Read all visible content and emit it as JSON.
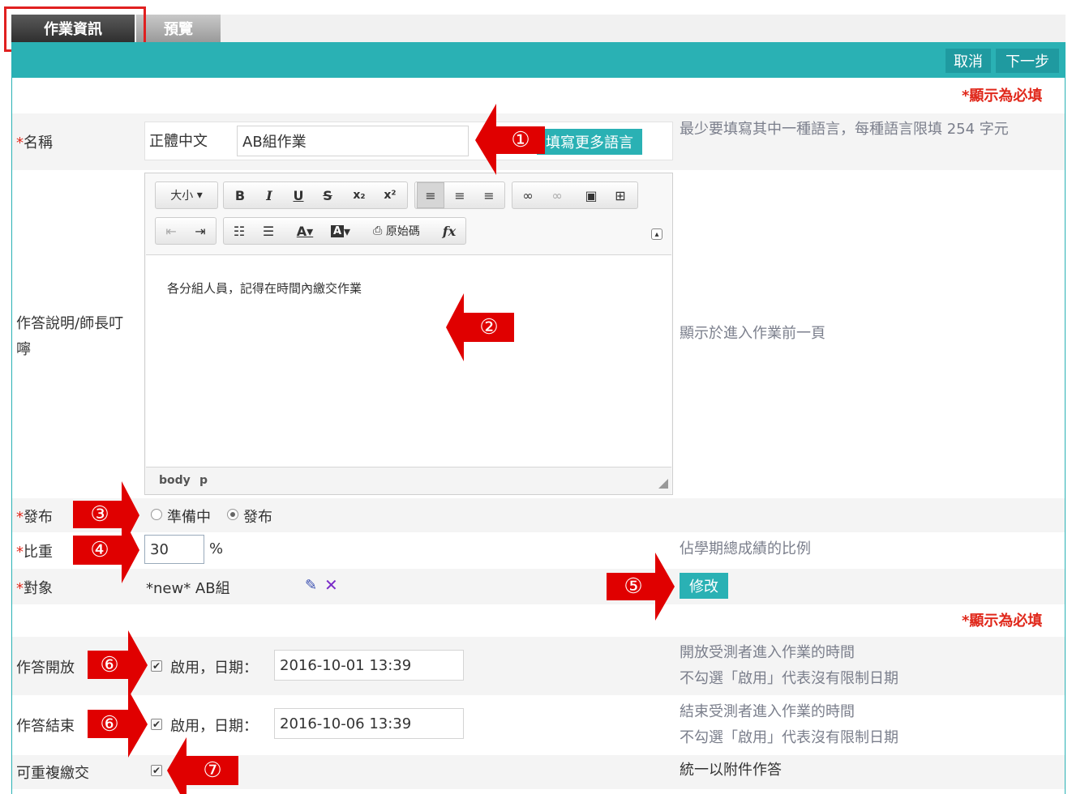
{
  "tabs": {
    "info": "作業資訊",
    "preview": "預覽"
  },
  "toolbar": {
    "cancel": "取消",
    "next": "下一步"
  },
  "required_note": "*顯示為必填",
  "required_star": "*",
  "form": {
    "name": {
      "label": "名稱",
      "lang": "正體中文",
      "value": "AB組作業",
      "more_lang": "填寫更多語言",
      "hint": "最少要填寫其中一種語言，每種語言限填 254 字元"
    },
    "description": {
      "label": "作答說明/師長叮嚀",
      "content": "各分組人員，記得在時間內繳交作業",
      "hint": "顯示於進入作業前一頁",
      "statusbar": [
        "body",
        "p"
      ],
      "editor_toolbar": {
        "size": "大小",
        "bold": "B",
        "italic": "I",
        "underline": "U",
        "strike": "S",
        "subscript": "x₂",
        "superscript": "x²",
        "source": "原始碼",
        "formula": "fx"
      }
    },
    "publish": {
      "label": "發布",
      "option_prepare": "準備中",
      "option_publish": "發布",
      "selected": "發布"
    },
    "weight": {
      "label": "比重",
      "value": "30",
      "unit": "%",
      "hint": "佔學期總成績的比例"
    },
    "target": {
      "label": "對象",
      "value": "*new* AB組",
      "modify": "修改"
    },
    "start": {
      "label": "作答開放",
      "enable": "啟用，日期：",
      "date": "2016-10-01 13:39",
      "hint1": "開放受測者進入作業的時間",
      "hint2": "不勾選「啟用」代表沒有限制日期"
    },
    "end": {
      "label": "作答結束",
      "enable": "啟用，日期：",
      "date": "2016-10-06 13:39",
      "hint1": "結束受測者進入作業的時間",
      "hint2": "不勾選「啟用」代表沒有限制日期"
    },
    "resubmit": {
      "label": "可重複繳交",
      "hint": "統一以附件作答"
    }
  },
  "markers": [
    "①",
    "②",
    "③",
    "④",
    "⑤",
    "⑥",
    "⑥",
    "⑦"
  ],
  "colors": {
    "teal": "#2ab1b4",
    "required": "#e0281b",
    "annotation": "#e00000"
  }
}
